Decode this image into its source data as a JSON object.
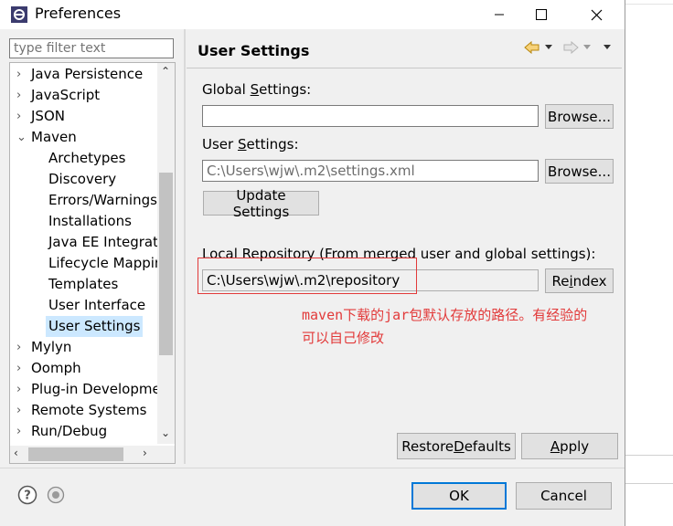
{
  "window": {
    "title": "Preferences"
  },
  "filter": {
    "placeholder": "type filter text"
  },
  "tree": {
    "items": [
      {
        "label": "Java Persistence",
        "level": 0,
        "arrow": "›"
      },
      {
        "label": "JavaScript",
        "level": 0,
        "arrow": "›"
      },
      {
        "label": "JSON",
        "level": 0,
        "arrow": "›"
      },
      {
        "label": "Maven",
        "level": 0,
        "arrow": "⌄"
      },
      {
        "label": "Archetypes",
        "level": 1,
        "arrow": ""
      },
      {
        "label": "Discovery",
        "level": 1,
        "arrow": ""
      },
      {
        "label": "Errors/Warnings",
        "level": 1,
        "arrow": ""
      },
      {
        "label": "Installations",
        "level": 1,
        "arrow": ""
      },
      {
        "label": "Java EE Integratio",
        "level": 1,
        "arrow": ""
      },
      {
        "label": "Lifecycle Mappin",
        "level": 1,
        "arrow": ""
      },
      {
        "label": "Templates",
        "level": 1,
        "arrow": ""
      },
      {
        "label": "User Interface",
        "level": 1,
        "arrow": ""
      },
      {
        "label": "User Settings",
        "level": 1,
        "arrow": "",
        "selected": true
      },
      {
        "label": "Mylyn",
        "level": 0,
        "arrow": "›"
      },
      {
        "label": "Oomph",
        "level": 0,
        "arrow": "›"
      },
      {
        "label": "Plug-in Developme",
        "level": 0,
        "arrow": "›"
      },
      {
        "label": "Remote Systems",
        "level": 0,
        "arrow": "›"
      },
      {
        "label": "Run/Debug",
        "level": 0,
        "arrow": "›"
      }
    ]
  },
  "page": {
    "title": "User Settings",
    "global_pre": "Global ",
    "global_ul": "S",
    "global_post": "ettings:",
    "global_value": "",
    "browse_label": "Browse...",
    "user_pre": "User ",
    "user_ul": "S",
    "user_post": "ettings:",
    "user_value": "C:\\Users\\wjw\\.m2\\settings.xml",
    "update_label": "Update Settings",
    "local_label": "Local Repository (From merged user and global settings):",
    "local_value": "C:\\Users\\wjw\\.m2\\repository",
    "reindex_pre": "Re",
    "reindex_ul": "i",
    "reindex_post": "ndex",
    "note_line1": "maven下载的jar包默认存放的路径。有经验的",
    "note_line2": "可以自己修改",
    "restore_pre": "Restore ",
    "restore_ul": "D",
    "restore_post": "efaults",
    "apply_ul": "A",
    "apply_post": "pply"
  },
  "footer": {
    "ok_label": "OK",
    "cancel_label": "Cancel"
  },
  "colors": {
    "accent": "#0078d7",
    "annotation": "#e23a3a",
    "selection": "#cce8ff"
  }
}
